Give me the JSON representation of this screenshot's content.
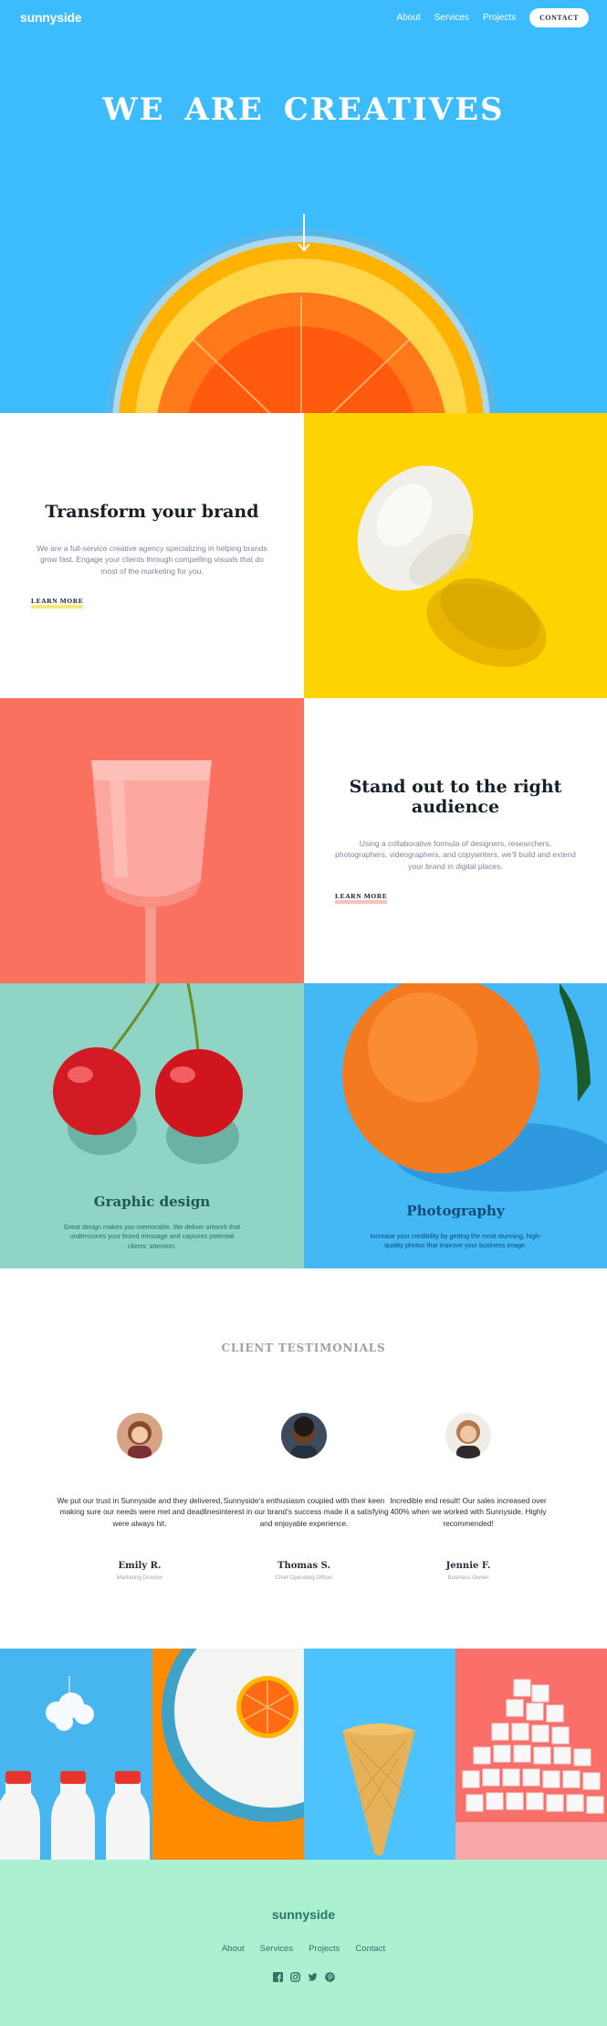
{
  "nav": {
    "logo": "sunnyside",
    "links": [
      "About",
      "Services",
      "Projects"
    ],
    "contact": "CONTACT"
  },
  "hero": {
    "title": "WE ARE CREATIVES"
  },
  "brand": {
    "title": "Transform your brand",
    "body": "We are a full-service creative agency specializing in helping brands grow fast. Engage your clients through compelling visuals that do most of the marketing for you.",
    "link": "LEARN MORE"
  },
  "audience": {
    "title": "Stand out to the right audience",
    "body": "Using a collaborative formula of designers, researchers, photographers, videographers, and copywriters, we’ll build and extend your brand in digital places.",
    "link": "LEARN MORE"
  },
  "services": [
    {
      "title": "Graphic design",
      "body": "Great design makes you memorable. We deliver artwork that underscores your brand message and captures potential clients’ attention."
    },
    {
      "title": "Photography",
      "body": "Increase your credibility by getting the most stunning, high-quality photos that improve your business image."
    }
  ],
  "testimonials": {
    "heading": "CLIENT TESTIMONIALS",
    "items": [
      {
        "quote": "We put our trust in Sunnyside and they delivered, making sure our needs were met and deadlines were always hit.",
        "name": "Emily R.",
        "role": "Marketing Director"
      },
      {
        "quote": "Sunnyside’s enthusiasm coupled with their keen interest in our brand’s success made it a satisfying and enjoyable experience.",
        "name": "Thomas S.",
        "role": "Chief Operating Officer"
      },
      {
        "quote": "Incredible end result! Our sales increased over 400% when we worked with Sunnyside. Highly recommended!",
        "name": "Jennie F.",
        "role": "Business Owner"
      }
    ]
  },
  "footer": {
    "logo": "sunnyside",
    "links": [
      "About",
      "Services",
      "Projects",
      "Contact"
    ],
    "social": [
      "facebook-icon",
      "instagram-icon",
      "twitter-icon",
      "pinterest-icon"
    ]
  },
  "colors": {
    "hero_blue": "#3dbcfd",
    "yellow": "#fed300",
    "coral": "#fa7160",
    "mint": "#90d4c5",
    "footer_mint": "#aaf0d1",
    "footer_text": "#2c7566"
  }
}
